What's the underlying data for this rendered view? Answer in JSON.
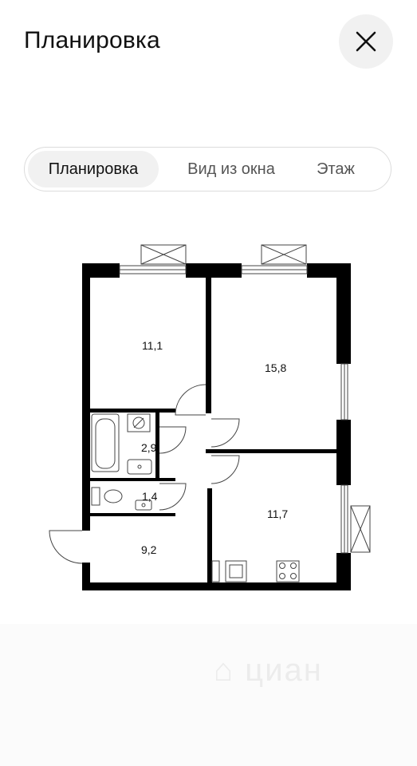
{
  "header": {
    "title": "Планировка",
    "close_icon": "close-icon"
  },
  "tabs": [
    {
      "label": "Планировка",
      "active": true
    },
    {
      "label": "Вид из окна",
      "active": false
    },
    {
      "label": "Этаж",
      "active": false
    }
  ],
  "floorplan": {
    "rooms": [
      {
        "label": "11,1"
      },
      {
        "label": "15,8"
      },
      {
        "label": "2,9"
      },
      {
        "label": "1,4"
      },
      {
        "label": "11,7"
      },
      {
        "label": "9,2"
      }
    ]
  },
  "watermark": {
    "text": "циан",
    "icon": "cian-logo-icon"
  }
}
